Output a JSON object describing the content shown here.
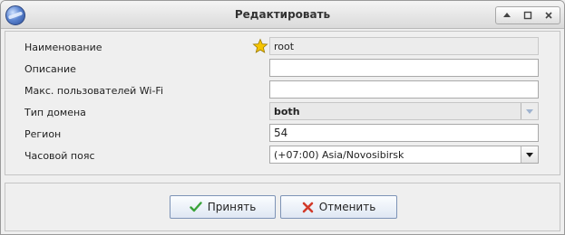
{
  "window": {
    "title": "Редактировать"
  },
  "form": {
    "name": {
      "label": "Наименование",
      "value": "root"
    },
    "description": {
      "label": "Описание",
      "value": ""
    },
    "max_wifi_users": {
      "label": "Макс. пользователей Wi-Fi",
      "value": ""
    },
    "domain_type": {
      "label": "Тип домена",
      "value": "both"
    },
    "region": {
      "label": "Регион",
      "value": "54"
    },
    "timezone": {
      "label": "Часовой пояс",
      "value": "(+07:00) Asia/Novosibirsk"
    }
  },
  "buttons": {
    "accept": "Принять",
    "cancel": "Отменить"
  },
  "icons": {
    "app": "globe-icon",
    "name_marker": "star-icon",
    "accept": "check-icon",
    "cancel": "cross-icon"
  },
  "colors": {
    "accent": "#7d93b6",
    "star": "#f5c400",
    "check": "#3aa33a",
    "cross": "#d23a2a"
  }
}
